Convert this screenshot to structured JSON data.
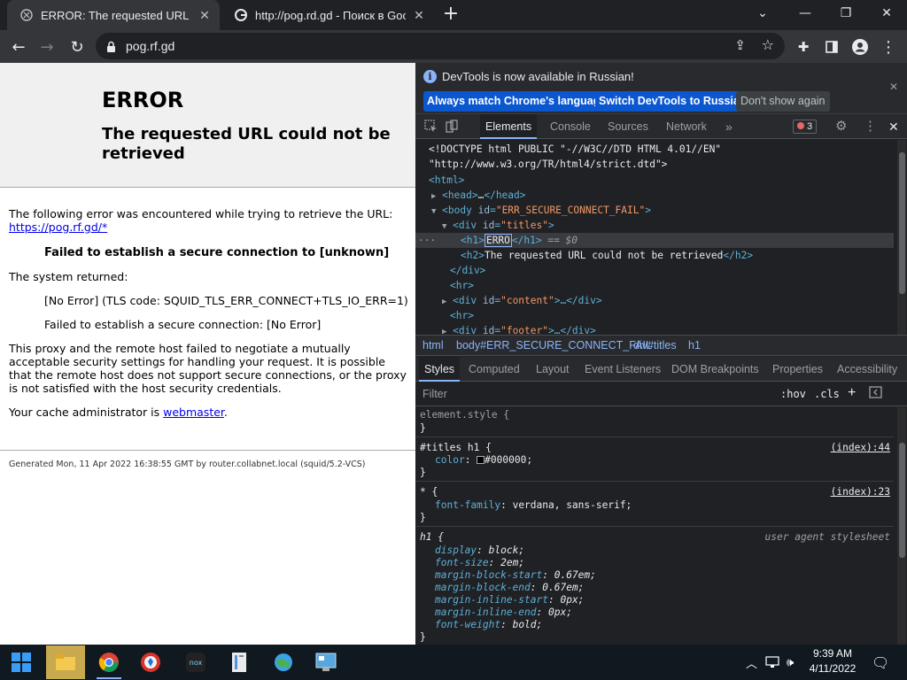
{
  "browser": {
    "tabs": [
      {
        "title": "ERROR: The requested URL could not be retrieved",
        "active": true
      },
      {
        "title": "http://pog.rd.gd - Поиск в Google",
        "active": false
      }
    ],
    "new_tab_label": "+",
    "url": "pog.rf.gd"
  },
  "page": {
    "h1": "ERROR",
    "h2": "The requested URL could not be retrieved",
    "intro": "The following error was encountered while trying to retrieve the URL:",
    "link": "https://pog.rf.gd/*",
    "error_bold": "Failed to establish a secure connection to [unknown]",
    "system_returned": "The system returned:",
    "sys1": "[No Error] (TLS code: SQUID_TLS_ERR_CONNECT+TLS_IO_ERR=1)",
    "sys2": "Failed to establish a secure connection: [No Error]",
    "explain": "This proxy and the remote host failed to negotiate a mutually acceptable security settings for handling your request. It is possible that the remote host does not support secure connections, or the proxy is not satisfied with the host security credentials.",
    "admin_prefix": "Your cache administrator is ",
    "admin_link": "webmaster",
    "admin_suffix": ".",
    "footer": "Generated Mon, 11 Apr 2022 16:38:55 GMT by router.collabnet.local (squid/5.2-VCS)"
  },
  "devtools": {
    "info_message": "DevTools is now available in Russian!",
    "btn_match": "Always match Chrome's language",
    "btn_switch": "Switch DevTools to Russian",
    "btn_dont": "Don't show again",
    "tabs": [
      "Elements",
      "Console",
      "Sources",
      "Network"
    ],
    "more_tabs": "»",
    "error_count": "3",
    "dom": {
      "l1": "<!DOCTYPE html PUBLIC \"-//W3C//DTD HTML 4.01//EN\"",
      "l2": "\"http://www.w3.org/TR/html4/strict.dtd\">",
      "l3": "<html>",
      "l4a": "<head>",
      "l4b": "…",
      "l4c": "</head>",
      "l5a": "<body ",
      "l5attr": "id",
      "l5val": "\"ERR_SECURE_CONNECT_FAIL\"",
      "l5c": ">",
      "l6a": "<div ",
      "l6attr": "id",
      "l6val": "\"titles\"",
      "l6c": ">",
      "l7a": "<h1>",
      "l7text": "ERRO",
      "l7c": "</h1>",
      "l7d": " == $0",
      "l8a": "<h2>",
      "l8text": "The requested URL could not be retrieved",
      "l8c": "</h2>",
      "l9": "</div>",
      "l10": "<hr>",
      "l11a": "<div ",
      "l11attr": "id",
      "l11val": "\"content\"",
      "l11b": ">…</div>",
      "l12": "<hr>",
      "l13a": "<div ",
      "l13attr": "id",
      "l13val": "\"footer\"",
      "l13b": ">…</div>"
    },
    "breadcrumb": [
      "html",
      "body#ERR_SECURE_CONNECT_FAIL",
      "div#titles",
      "h1"
    ],
    "subtabs": [
      "Styles",
      "Computed",
      "Layout",
      "Event Listeners",
      "DOM Breakpoints",
      "Properties",
      "Accessibility"
    ],
    "filter_placeholder": "Filter",
    "hov": ":hov",
    "cls": ".cls",
    "styles": {
      "element_style": "element.style {",
      "close": "}",
      "r1_sel": "#titles h1 {",
      "r1_src": "(index):44",
      "r1_prop": "color",
      "r1_val": "#000000;",
      "r2_sel": "* {",
      "r2_src": "(index):23",
      "r2_prop": "font-family",
      "r2_val": "verdana, sans-serif;",
      "r3_sel": "h1 {",
      "r3_src": "user agent stylesheet",
      "r3_props": [
        {
          "prop": "display",
          "val": "block;"
        },
        {
          "prop": "font-size",
          "val": "2em;"
        },
        {
          "prop": "margin-block-start",
          "val": "0.67em;"
        },
        {
          "prop": "margin-block-end",
          "val": "0.67em;"
        },
        {
          "prop": "margin-inline-start",
          "val": "0px;"
        },
        {
          "prop": "margin-inline-end",
          "val": "0px;"
        },
        {
          "prop": "font-weight",
          "val": "bold;"
        }
      ]
    }
  },
  "taskbar": {
    "time": "9:39 AM",
    "date": "4/11/2022"
  },
  "colors": {
    "chrome_dark": "#202124",
    "devtools_tag": "#5db0d7",
    "devtools_val": "#f29766",
    "accent_blue": "#0b57d0"
  }
}
